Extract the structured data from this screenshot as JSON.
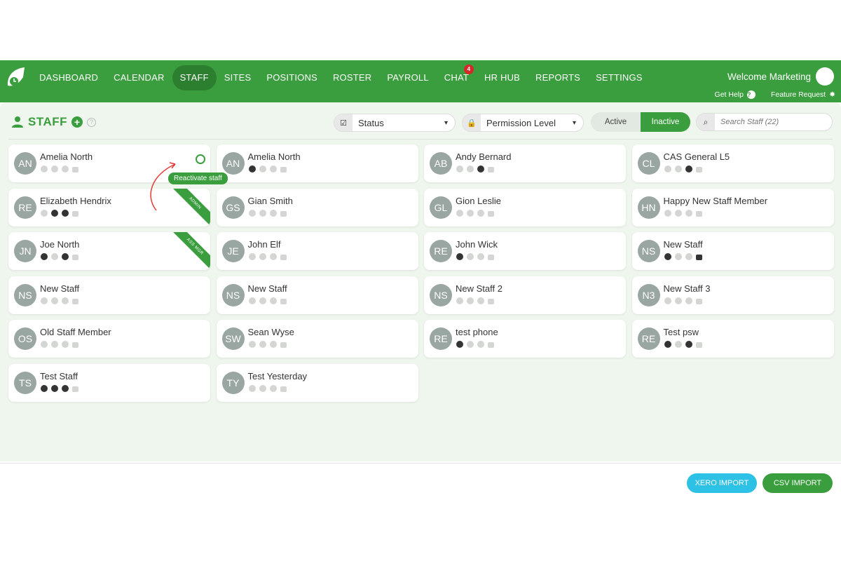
{
  "header": {
    "nav": [
      {
        "label": "DASHBOARD"
      },
      {
        "label": "CALENDAR"
      },
      {
        "label": "STAFF",
        "active": true
      },
      {
        "label": "SITES"
      },
      {
        "label": "POSITIONS"
      },
      {
        "label": "ROSTER"
      },
      {
        "label": "PAYROLL"
      },
      {
        "label": "CHAT",
        "badge": "4"
      },
      {
        "label": "HR HUB"
      },
      {
        "label": "REPORTS"
      },
      {
        "label": "SETTINGS"
      }
    ],
    "welcome": "Welcome Marketing",
    "get_help": "Get Help",
    "feature_request": "Feature Request"
  },
  "page": {
    "title": "STAFF",
    "status_label": "Status",
    "permission_label": "Permission Level",
    "toggle_active": "Active",
    "toggle_inactive": "Inactive",
    "search_placeholder": "Search Staff (22)"
  },
  "tooltip": "Reactivate staff",
  "staff": [
    {
      "initials": "AN",
      "name": "Amelia North",
      "icons": [
        0,
        0,
        0,
        0
      ],
      "reactivate": true
    },
    {
      "initials": "AN",
      "name": "Amelia North",
      "icons": [
        1,
        0,
        0,
        0
      ]
    },
    {
      "initials": "AB",
      "name": "Andy Bernard",
      "icons": [
        0,
        0,
        1,
        0
      ]
    },
    {
      "initials": "CL",
      "name": "CAS General L5",
      "icons": [
        0,
        0,
        1,
        0
      ]
    },
    {
      "initials": "RE",
      "name": "Elizabeth Hendrix",
      "icons": [
        0,
        1,
        1,
        0
      ],
      "ribbon": "ADMIN"
    },
    {
      "initials": "GS",
      "name": "Gian Smith",
      "icons": [
        0,
        0,
        0,
        0
      ]
    },
    {
      "initials": "GL",
      "name": "Gion Leslie",
      "icons": [
        0,
        0,
        0,
        0
      ]
    },
    {
      "initials": "HN",
      "name": "Happy New Staff Member",
      "icons": [
        0,
        0,
        0,
        0
      ]
    },
    {
      "initials": "JN",
      "name": "Joe North",
      "icons": [
        1,
        0,
        1,
        0
      ],
      "ribbon": "ASS MGR"
    },
    {
      "initials": "JE",
      "name": "John Elf",
      "icons": [
        0,
        0,
        0,
        0
      ]
    },
    {
      "initials": "RE",
      "name": "John Wick",
      "icons": [
        1,
        0,
        0,
        0
      ]
    },
    {
      "initials": "NS",
      "name": "New Staff",
      "icons": [
        1,
        0,
        0,
        1
      ]
    },
    {
      "initials": "NS",
      "name": "New Staff",
      "icons": [
        0,
        0,
        0,
        0
      ]
    },
    {
      "initials": "NS",
      "name": "New Staff",
      "icons": [
        0,
        0,
        0,
        0
      ]
    },
    {
      "initials": "NS",
      "name": "New Staff 2",
      "icons": [
        0,
        0,
        0,
        0
      ]
    },
    {
      "initials": "N3",
      "name": "New Staff 3",
      "icons": [
        0,
        0,
        0,
        0
      ]
    },
    {
      "initials": "OS",
      "name": "Old Staff Member",
      "icons": [
        0,
        0,
        0,
        0
      ]
    },
    {
      "initials": "SW",
      "name": "Sean Wyse",
      "icons": [
        0,
        0,
        0,
        0
      ]
    },
    {
      "initials": "RE",
      "name": "test phone",
      "icons": [
        1,
        0,
        0,
        0
      ]
    },
    {
      "initials": "RE",
      "name": "Test psw",
      "icons": [
        1,
        0,
        1,
        0
      ]
    },
    {
      "initials": "TS",
      "name": "Test Staff",
      "icons": [
        1,
        1,
        1,
        0
      ]
    },
    {
      "initials": "TY",
      "name": "Test Yesterday",
      "icons": [
        0,
        0,
        0,
        0
      ]
    }
  ],
  "footer": {
    "xero": "XERO IMPORT",
    "csv": "CSV IMPORT"
  },
  "colors": {
    "brand": "#3a9e3e",
    "xero": "#2cc1e5"
  }
}
